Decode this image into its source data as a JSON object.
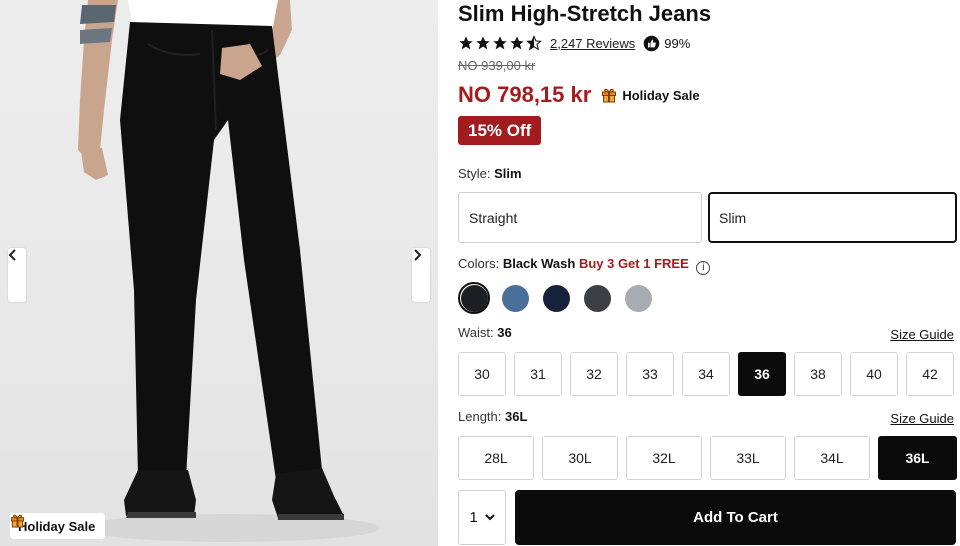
{
  "gallery": {
    "badge_label": "Holiday Sale"
  },
  "product": {
    "title": "Slim High-Stretch Jeans",
    "rating": 4.5,
    "reviews_label": "2,247 Reviews",
    "recommend_pct": "99%",
    "original_price": "NO 939,00 kr",
    "sale_price": "NO 798,15 kr",
    "sale_tag": "Holiday Sale",
    "discount_badge": "15% Off"
  },
  "style": {
    "label": "Style:",
    "selected": "Slim",
    "options": [
      "Straight",
      "Slim"
    ]
  },
  "colors": {
    "label": "Colors:",
    "selected": "Black Wash",
    "promo": "Buy 3 Get 1 FREE",
    "info_glyph": "i",
    "swatches": [
      {
        "name": "black-wash",
        "hex": "#1e1f24"
      },
      {
        "name": "medium-blue",
        "hex": "#4a6f99"
      },
      {
        "name": "navy",
        "hex": "#16223b"
      },
      {
        "name": "charcoal",
        "hex": "#3d3f44"
      },
      {
        "name": "light-gray",
        "hex": "#a7abb2"
      }
    ]
  },
  "waist": {
    "label": "Waist:",
    "selected": "36",
    "size_guide": "Size Guide",
    "options": [
      "30",
      "31",
      "32",
      "33",
      "34",
      "36",
      "38",
      "40",
      "42"
    ]
  },
  "length": {
    "label": "Length:",
    "selected": "36L",
    "size_guide": "Size Guide",
    "options": [
      "28L",
      "30L",
      "32L",
      "33L",
      "34L",
      "36L"
    ]
  },
  "cart": {
    "quantity": "1",
    "add_label": "Add To Cart"
  },
  "colors_theme": {
    "accent_red": "#a51c1c",
    "discount_bg": "#a21b1f",
    "selected_bg": "#0b0b0b"
  }
}
